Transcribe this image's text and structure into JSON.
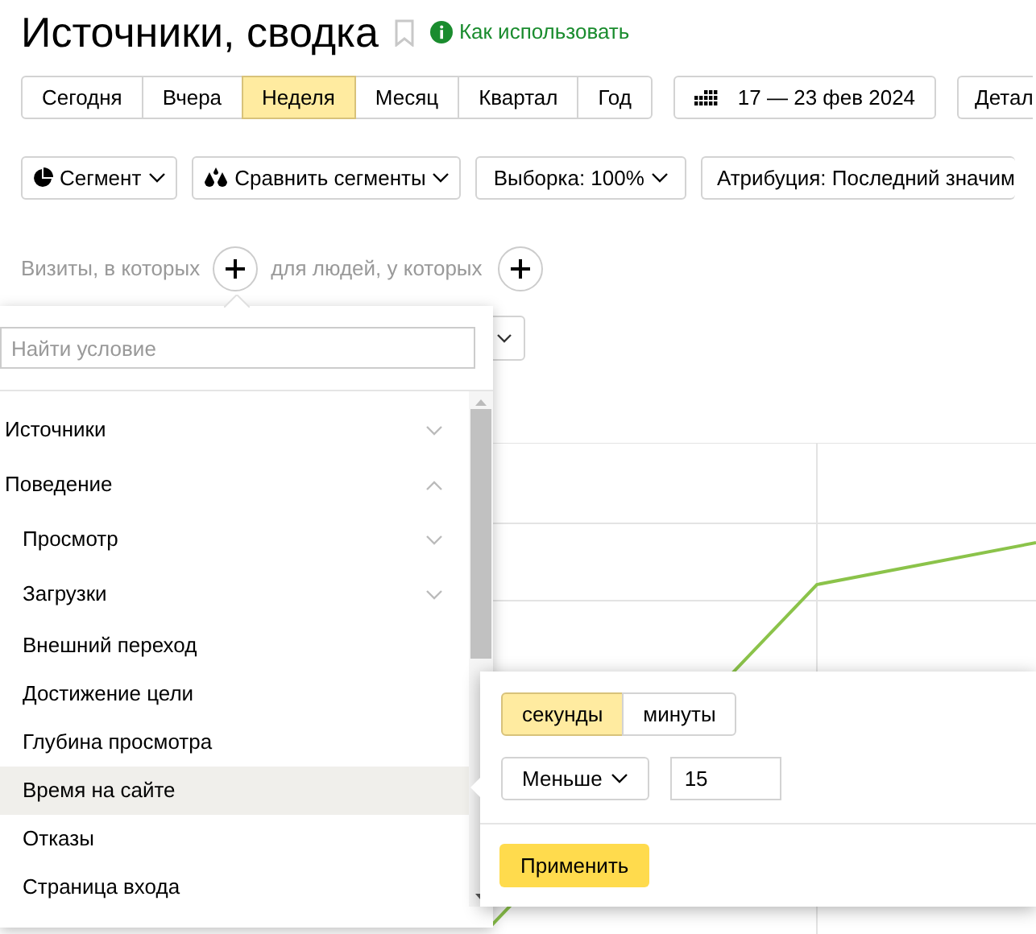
{
  "header": {
    "title": "Источники, сводка",
    "help_link": "Как использовать"
  },
  "periods": [
    {
      "label": "Сегодня",
      "selected": false
    },
    {
      "label": "Вчера",
      "selected": false
    },
    {
      "label": "Неделя",
      "selected": true
    },
    {
      "label": "Месяц",
      "selected": false
    },
    {
      "label": "Квартал",
      "selected": false
    },
    {
      "label": "Год",
      "selected": false
    }
  ],
  "date_range": "17 — 23 фев 2024",
  "details_button": "Детал",
  "toolbar": [
    {
      "kind": "segment",
      "label": "Сегмент"
    },
    {
      "kind": "compare",
      "label": "Сравнить сегменты"
    },
    {
      "kind": "plain",
      "label": "Выборка: 100%"
    },
    {
      "kind": "attribution",
      "label": "Атрибуция: Последний значим"
    }
  ],
  "segment_builder": {
    "visits_label": "Визиты, в которых",
    "people_label": "для людей, у которых"
  },
  "condition_menu": {
    "search": {
      "placeholder": "Найти условие"
    },
    "items": [
      {
        "label": "Источники",
        "expanded": false,
        "selected": false
      },
      {
        "label": "Поведение",
        "expanded": true,
        "selected": false,
        "children": [
          {
            "label": "Просмотр",
            "expanded": false,
            "selected": false
          },
          {
            "label": "Загрузки",
            "expanded": false,
            "selected": false
          },
          {
            "label": "Внешний переход",
            "selected": false
          },
          {
            "label": "Достижение цели",
            "selected": false
          },
          {
            "label": "Глубина просмотра",
            "selected": false
          },
          {
            "label": "Время на сайте",
            "selected": true
          },
          {
            "label": "Отказы",
            "selected": false
          },
          {
            "label": "Страница входа",
            "selected": false
          }
        ]
      }
    ]
  },
  "value_popup": {
    "units": [
      {
        "label": "секунды",
        "selected": true
      },
      {
        "label": "минуты",
        "selected": false
      }
    ],
    "operator": "Меньше",
    "value": "15",
    "apply_button": "Применить"
  }
}
